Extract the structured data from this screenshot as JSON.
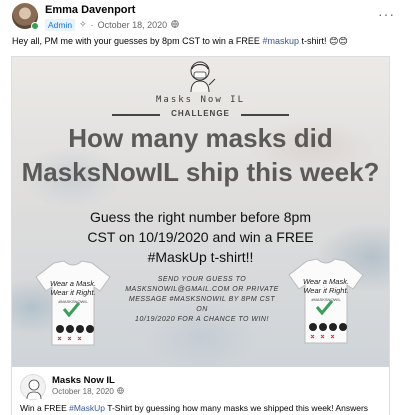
{
  "post": {
    "author": "Emma Davenport",
    "badge": "Admin",
    "badge_icon": "✧",
    "separator": "·",
    "date": "October 18, 2020",
    "privacy_icon": "globe-icon",
    "more_icon": "···",
    "text_before_tag": "Hey all, PM me with your guesses by 8pm CST to win a FREE ",
    "hashtag": "#maskup",
    "text_after_tag": " t-shirt! 😊😊"
  },
  "graphic": {
    "brand": "Masks Now IL",
    "challenge_label": "CHALLENGE",
    "headline_line1": "How many masks did",
    "headline_line2": "MasksNowIL ship this week?",
    "subline_line1": "Guess the right number before 8pm",
    "subline_line2": "CST on 10/19/2020 and win a FREE",
    "subline_line3": "#MaskUp t-shirt!!",
    "send_note_line1": "Send your guess to",
    "send_note_line2": "masksnowil@gmail.com or private",
    "send_note_line3": "message #masksnowil by 8pm CST on",
    "send_note_line4": "10/19/2020 for a chance to win!",
    "shirt_slogan_line1": "Wear a Mask.",
    "shirt_slogan_line2": "Wear it Right.",
    "shirt_tag": "#MASKSNOWIL"
  },
  "shared": {
    "page_name": "Masks Now IL",
    "date": "October 18, 2020",
    "text_before_tag": "Win a FREE ",
    "hashtag": "#MaskUp",
    "text_after_tag": " T-Shirt by guessing how many masks we shipped this week!  Answers"
  },
  "colors": {
    "accent": "#1b74e4",
    "hashtag": "#385898",
    "online": "#31a24c"
  }
}
